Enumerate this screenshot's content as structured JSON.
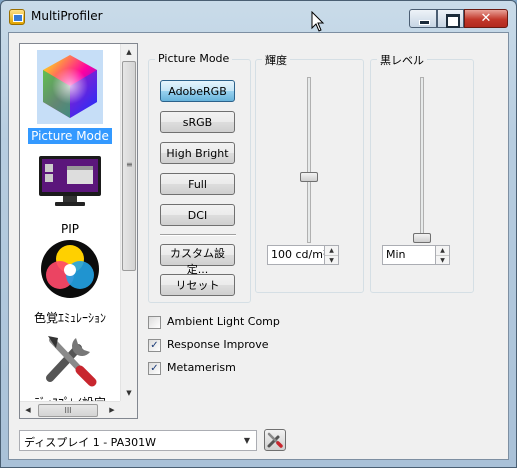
{
  "window": {
    "title": "MultiProfiler"
  },
  "sidebar": {
    "items": [
      {
        "label": "Picture Mode",
        "selected": true,
        "icon": "color-cube-icon"
      },
      {
        "label": "PIP",
        "icon": "monitor-icon"
      },
      {
        "label": "色覚ｴﾐｭﾚｰｼｮﾝ",
        "icon": "color-circles-icon"
      },
      {
        "label": "ﾃﾞｨｽﾌﾟﾚｲ設定",
        "icon": "tools-icon"
      }
    ]
  },
  "picture_mode": {
    "title": "Picture Mode",
    "buttons": [
      {
        "label": "AdobeRGB",
        "active": true
      },
      {
        "label": "sRGB"
      },
      {
        "label": "High Bright"
      },
      {
        "label": "Full"
      },
      {
        "label": "DCI"
      }
    ],
    "custom_label": "カスタム設定...",
    "reset_label": "リセット"
  },
  "brightness": {
    "title": "輝度",
    "value": "100 cd/m²",
    "level": 0.39
  },
  "black_level": {
    "title": "黒レベル",
    "value": "Min",
    "level": 0.0
  },
  "checkboxes": [
    {
      "label": "Ambient Light Comp",
      "checked": false
    },
    {
      "label": "Response Improve",
      "checked": true
    },
    {
      "label": "Metamerism",
      "checked": true
    }
  ],
  "display_select": {
    "value": "ディスプレイ 1 - PA301W"
  },
  "colors": {
    "selection": "#3399ff",
    "active_button": "#68b3db",
    "close_button": "#c2382b"
  }
}
